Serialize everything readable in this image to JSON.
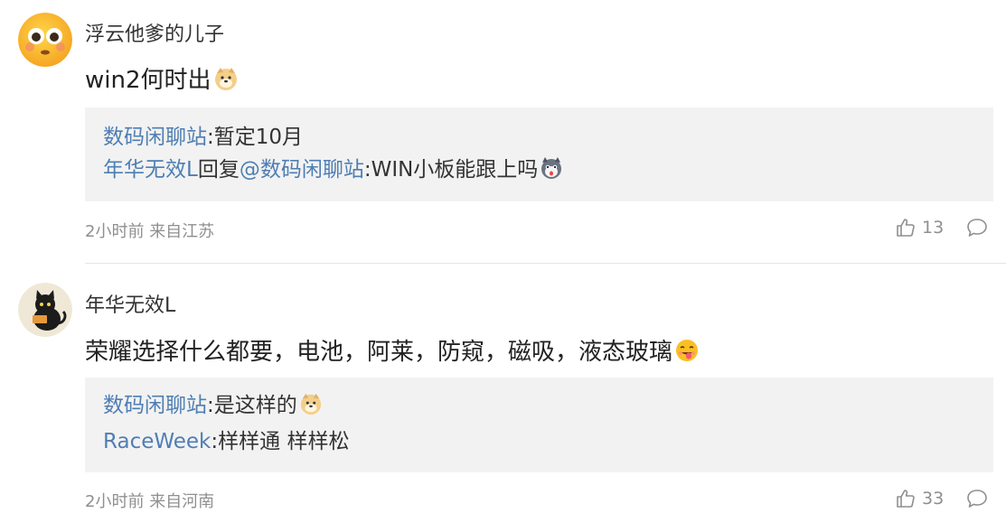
{
  "comments": [
    {
      "username": "浮云他爹的儿子",
      "content": "win2何时出",
      "content_emoji": "doge-emoji",
      "replies": [
        {
          "author": "数码闲聊站",
          "separator": ":",
          "text": "暂定10月"
        },
        {
          "author": "年华无效L",
          "reply_word": "回复",
          "mention": "@数码闲聊站",
          "separator": ":",
          "text": "WIN小板能跟上吗",
          "emoji": "husky-emoji"
        }
      ],
      "time": "2小时前",
      "location": "来自江苏",
      "likes": "13"
    },
    {
      "username": "年华无效L",
      "content": "荣耀选择什么都要，电池，阿莱，防窥，磁吸，液态玻璃",
      "content_emoji": "tongue-emoji",
      "replies": [
        {
          "author": "数码闲聊站",
          "separator": ":",
          "text": "是这样的",
          "emoji": "doge-emoji"
        },
        {
          "author": "RaceWeek",
          "separator": ":",
          "text": "样样通 样样松"
        }
      ],
      "time": "2小时前",
      "location": "来自河南",
      "likes": "33"
    }
  ],
  "colors": {
    "link": "#4f7eb3",
    "meta": "#8f8f8f",
    "reply_bg": "#f2f2f2"
  }
}
